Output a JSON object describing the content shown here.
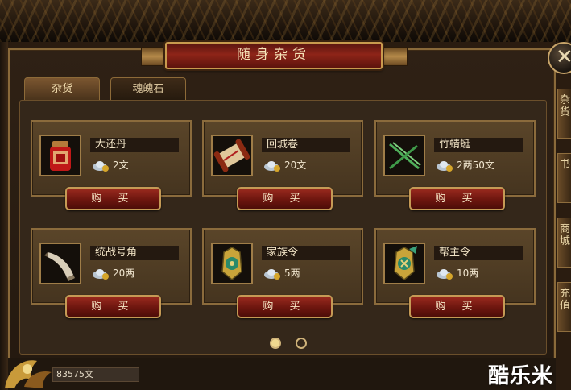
{
  "window": {
    "title": "随身杂货",
    "close_symbol": "✕"
  },
  "tabs": [
    {
      "label": "杂货",
      "active": true
    },
    {
      "label": "魂魄石",
      "active": false
    }
  ],
  "items": [
    {
      "name": "大还丹",
      "price": "2文",
      "buy_label": "购 买",
      "icon": "red-pill-jar-icon"
    },
    {
      "name": "回城卷",
      "price": "20文",
      "buy_label": "购 买",
      "icon": "scroll-icon"
    },
    {
      "name": "竹蜻蜓",
      "price": "2两50文",
      "buy_label": "购 买",
      "icon": "bamboo-dragonfly-icon"
    },
    {
      "name": "统战号角",
      "price": "20两",
      "buy_label": "购 买",
      "icon": "war-horn-icon"
    },
    {
      "name": "家族令",
      "price": "5两",
      "buy_label": "购 买",
      "icon": "clan-token-icon"
    },
    {
      "name": "帮主令",
      "price": "10两",
      "buy_label": "购 买",
      "icon": "guild-leader-token-icon"
    }
  ],
  "pager": {
    "pages": 2,
    "current": 1
  },
  "currency": {
    "value": "83575文"
  },
  "side_tabs": [
    "杂货",
    "书",
    "商城",
    "充值"
  ],
  "watermark": "酷乐米",
  "colors": {
    "accent": "#c59a55",
    "button_red": "#7a1a12",
    "title_red": "#8e2418"
  }
}
